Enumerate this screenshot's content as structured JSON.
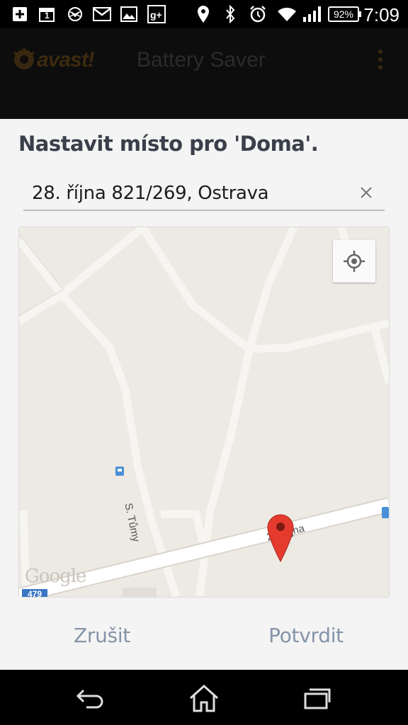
{
  "status_bar": {
    "time": "7:09",
    "battery_percent": "92%",
    "calendar_day": "1",
    "icons": [
      "add-icon",
      "calendar-icon",
      "sync-icon",
      "gmail-icon",
      "gallery-icon",
      "google-plus-icon",
      "location-icon",
      "bluetooth-icon",
      "alarm-icon",
      "wifi-icon",
      "signal-icon",
      "battery-icon"
    ]
  },
  "app_bar": {
    "logo_text": "avast!",
    "title": "Battery Saver"
  },
  "dialog": {
    "title": "Nastavit místo pro 'Doma'.",
    "address_value": "28. října 821/269, Ostrava",
    "map": {
      "street_labels": [
        "S. Tůmy",
        "28. října"
      ],
      "attribution": "Google",
      "route_shield": "479"
    },
    "cancel_label": "Zrušit",
    "confirm_label": "Potvrdit"
  },
  "colors": {
    "dialog_bg": "#f4f4f4",
    "title_text": "#3a3f4a",
    "action_text": "#8594a8",
    "map_bg": "#ede9e3",
    "marker_red": "#e53b2f"
  }
}
